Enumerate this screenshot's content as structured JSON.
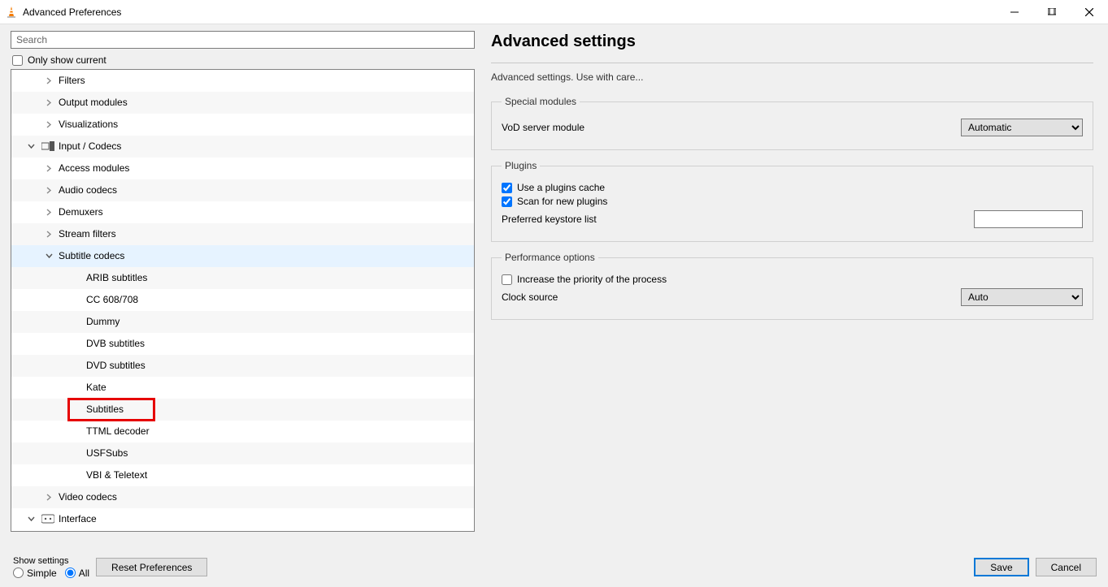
{
  "window": {
    "title": "Advanced Preferences"
  },
  "search": {
    "placeholder": "Search"
  },
  "only_show_current": "Only show current",
  "tree": {
    "items": [
      {
        "label": "Filters",
        "depth": 2,
        "exp": ">"
      },
      {
        "label": "Output modules",
        "depth": 2,
        "exp": ">"
      },
      {
        "label": "Visualizations",
        "depth": 2,
        "exp": ">"
      },
      {
        "label": "Input / Codecs",
        "depth": 1,
        "exp": "v",
        "icon": "input-codecs-icon"
      },
      {
        "label": "Access modules",
        "depth": 2,
        "exp": ">"
      },
      {
        "label": "Audio codecs",
        "depth": 2,
        "exp": ">"
      },
      {
        "label": "Demuxers",
        "depth": 2,
        "exp": ">"
      },
      {
        "label": "Stream filters",
        "depth": 2,
        "exp": ">"
      },
      {
        "label": "Subtitle codecs",
        "depth": 2,
        "exp": "v",
        "selected": true
      },
      {
        "label": "ARIB subtitles",
        "depth": 3
      },
      {
        "label": "CC 608/708",
        "depth": 3
      },
      {
        "label": "Dummy",
        "depth": 3
      },
      {
        "label": "DVB subtitles",
        "depth": 3
      },
      {
        "label": "DVD subtitles",
        "depth": 3
      },
      {
        "label": "Kate",
        "depth": 3
      },
      {
        "label": "Subtitles",
        "depth": 3,
        "highlight": true
      },
      {
        "label": "TTML decoder",
        "depth": 3
      },
      {
        "label": "USFSubs",
        "depth": 3
      },
      {
        "label": "VBI & Teletext",
        "depth": 3
      },
      {
        "label": "Video codecs",
        "depth": 2,
        "exp": ">"
      },
      {
        "label": "Interface",
        "depth": 1,
        "exp": "v",
        "icon": "interface-icon"
      }
    ]
  },
  "right": {
    "heading": "Advanced settings",
    "subtitle": "Advanced settings. Use with care...",
    "special": {
      "legend": "Special modules",
      "vod_label": "VoD server module",
      "vod_value": "Automatic"
    },
    "plugins": {
      "legend": "Plugins",
      "use_cache": "Use a plugins cache",
      "scan_new": "Scan for new plugins",
      "keystore_label": "Preferred keystore list",
      "keystore_value": ""
    },
    "perf": {
      "legend": "Performance options",
      "increase_priority": "Increase the priority of the process",
      "clock_label": "Clock source",
      "clock_value": "Auto"
    }
  },
  "footer": {
    "show_settings": "Show settings",
    "simple": "Simple",
    "all": "All",
    "reset": "Reset Preferences",
    "save": "Save",
    "cancel": "Cancel"
  }
}
